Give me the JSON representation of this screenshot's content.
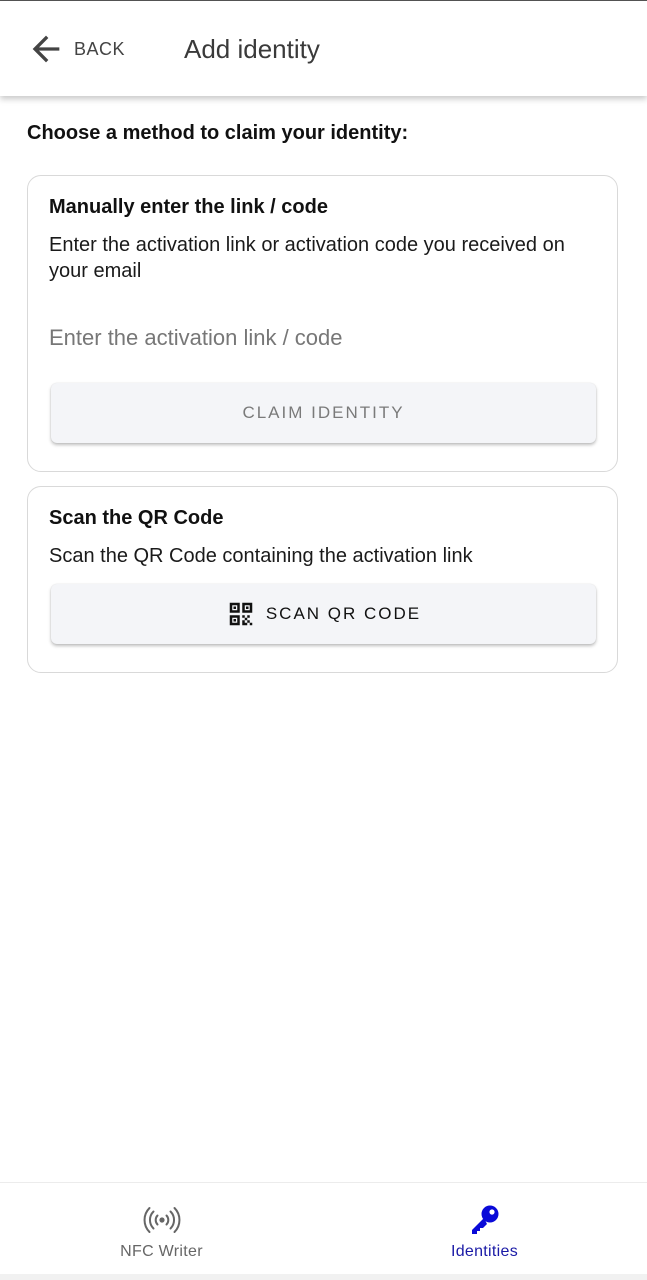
{
  "header": {
    "back_label": "BACK",
    "title": "Add identity"
  },
  "main": {
    "instruction": "Choose a method to claim your identity:",
    "manual_card": {
      "title": "Manually enter the link / code",
      "description": "Enter the activation link or activation code you received on your email",
      "input_placeholder": "Enter the activation link / code",
      "input_value": "",
      "button_label": "CLAIM IDENTITY"
    },
    "qr_card": {
      "title": "Scan the QR Code",
      "description": "Scan the QR Code containing the activation link",
      "button_label": "SCAN QR CODE",
      "button_icon": "qr-code-icon"
    }
  },
  "bottom_nav": {
    "items": [
      {
        "label": "NFC Writer",
        "icon": "nfc-icon",
        "active": false
      },
      {
        "label": "Identities",
        "icon": "key-icon",
        "active": true
      }
    ]
  },
  "colors": {
    "accent": "#1a1aa6",
    "key_icon": "#0a0ad8",
    "button_bg": "#f4f5f8",
    "disabled_text": "#7a7a7a"
  }
}
